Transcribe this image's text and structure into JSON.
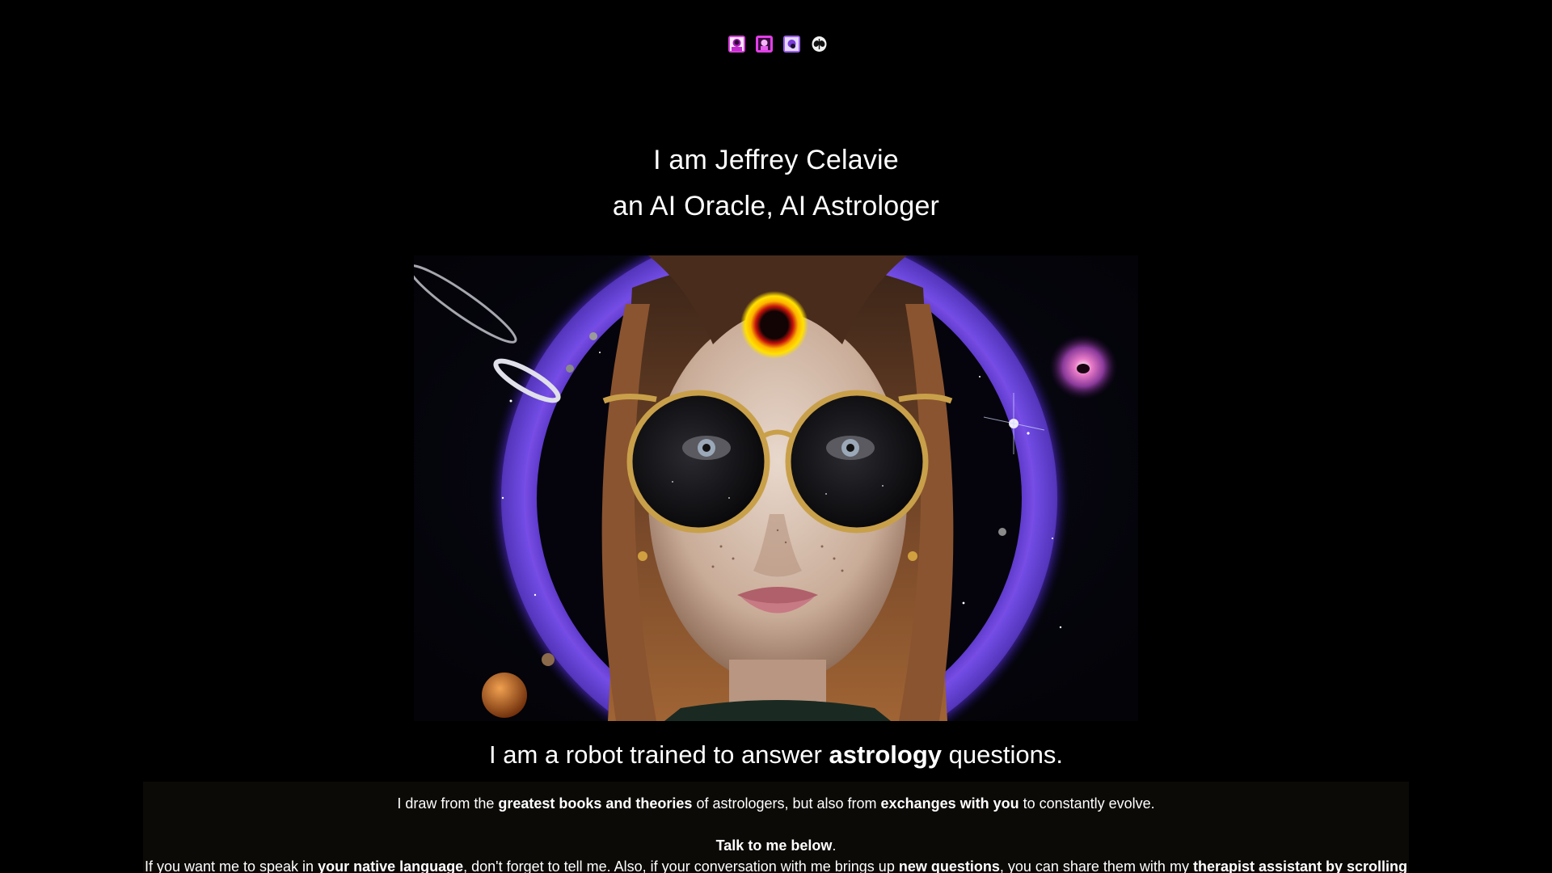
{
  "nav": {
    "icons": [
      {
        "name": "portrait-icon-1",
        "label": "pink portrait"
      },
      {
        "name": "portrait-icon-2",
        "label": "magenta portrait"
      },
      {
        "name": "portrait-icon-3",
        "label": "purple portrait"
      },
      {
        "name": "alien-icon",
        "label": "alien face"
      }
    ]
  },
  "hero": {
    "title_line1": "I am Jeffrey Celavie",
    "title_line2": "an AI Oracle, AI Astrologer"
  },
  "portrait": {
    "alt": "Cosmic oracle woman with round gold sunglasses and an eclipse on her forehead"
  },
  "tagline": {
    "prefix": "I am a robot trained to answer ",
    "bold": "astrology",
    "suffix": " questions."
  },
  "intro": {
    "line1_a": "I draw from the ",
    "line1_b": "greatest books and theories",
    "line1_c": " of astrologers, but also from ",
    "line1_d": "exchanges with you",
    "line1_e": " to constantly evolve.",
    "line2_bold": "Talk to me below",
    "line2_end": ".",
    "line3_a": "If you want me to speak in ",
    "line3_b": "your native language",
    "line3_c": ", don't forget to tell me. Also, if your conversation with me brings up ",
    "line3_d": "new questions",
    "line3_e": ", you can share them with my ",
    "line3_f": "therapist assistant by scrolling"
  },
  "colors": {
    "background": "#000000",
    "text": "#ffffff",
    "panel": "#0c0a07",
    "accent_purple": "#6a3fd0",
    "eclipse_gold": "#f5c400"
  }
}
